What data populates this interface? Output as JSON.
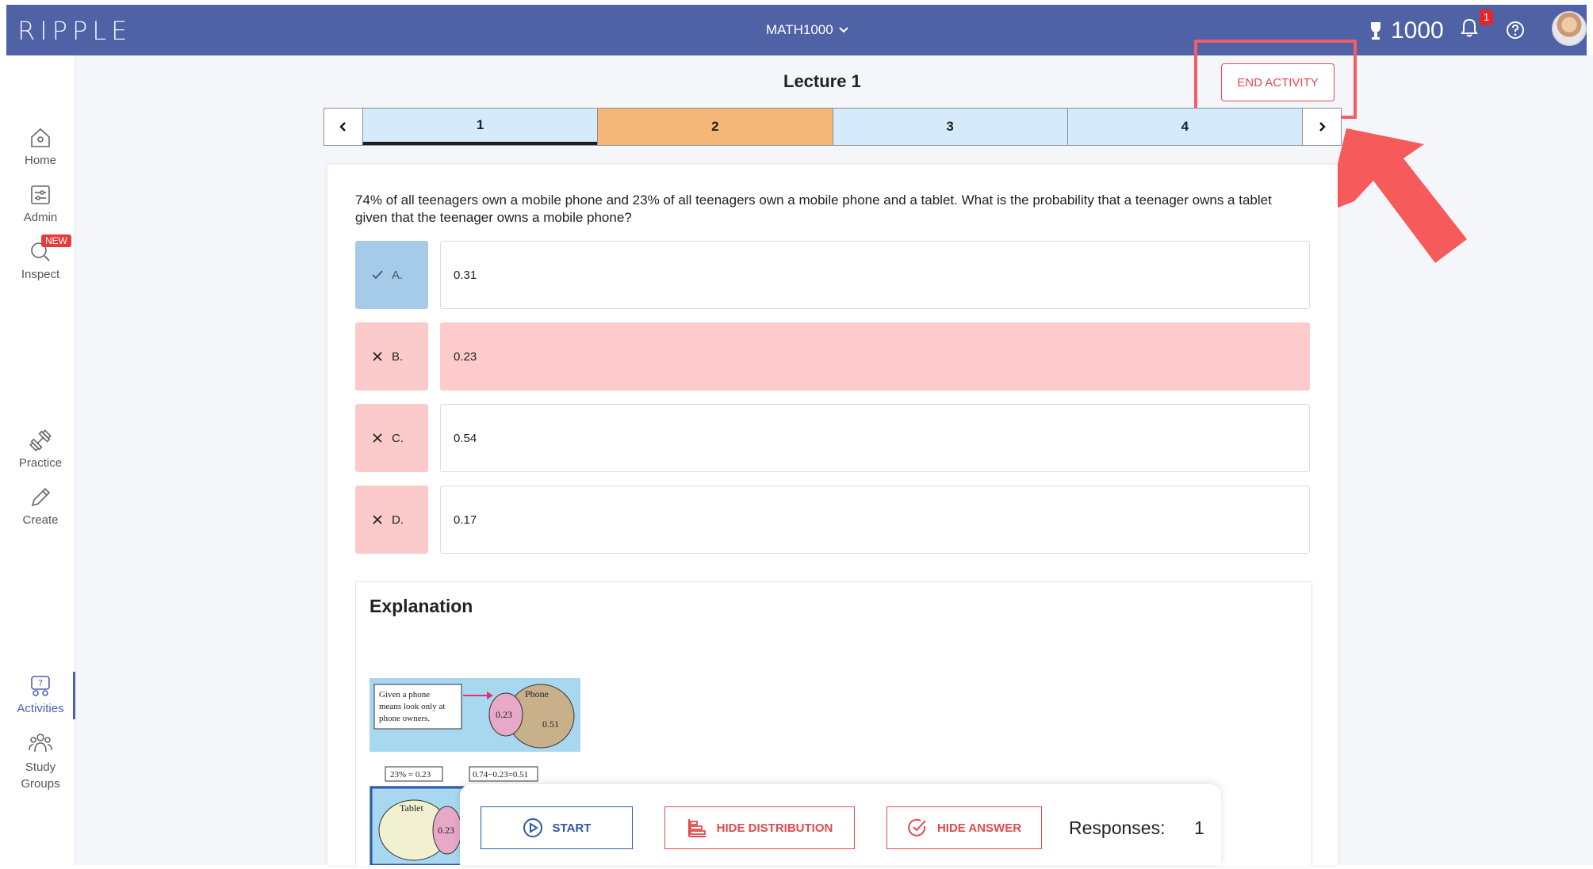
{
  "header": {
    "logo": "RIPPLE",
    "course": "MATH1000",
    "points": "1000",
    "notifications": "1"
  },
  "sidebar": {
    "items": [
      {
        "label": "Home",
        "icon": "home-icon"
      },
      {
        "label": "Admin",
        "icon": "admin-icon"
      },
      {
        "label": "Inspect",
        "icon": "inspect-icon",
        "badge": "NEW"
      },
      {
        "label": "Practice",
        "icon": "dumbbell-icon"
      },
      {
        "label": "Create",
        "icon": "pencil-icon"
      },
      {
        "label": "Activities",
        "icon": "activities-icon",
        "active": true
      },
      {
        "label": "Study",
        "label2": "Groups",
        "icon": "study-groups-icon"
      }
    ]
  },
  "activity": {
    "title": "Lecture 1",
    "end_label": "END ACTIVITY",
    "tabs": [
      "1",
      "2",
      "3",
      "4"
    ],
    "current_tab": "2"
  },
  "question": {
    "text": "74% of all teenagers own a mobile phone and 23% of all teenagers own a mobile phone and a tablet. What is the probability that a teenager owns a tablet given that the teenager owns a mobile phone?",
    "options": [
      {
        "letter": "A.",
        "text": "0.31",
        "status": "correct"
      },
      {
        "letter": "B.",
        "text": "0.23",
        "status": "wrong-selected"
      },
      {
        "letter": "C.",
        "text": "0.54",
        "status": "wrong"
      },
      {
        "letter": "D.",
        "text": "0.17",
        "status": "wrong"
      }
    ]
  },
  "explanation": {
    "title": "Explanation",
    "fig1_note": [
      "Given a phone",
      "means look only at",
      "phone owners."
    ],
    "fig1_circle_label": "Phone",
    "fig1_inner": "0.23",
    "fig1_outer": "0.51",
    "fig2_box1": "23% = 0.23",
    "fig2_box2": "0.74−0.23=0.51",
    "fig2_label": "Tablet",
    "fig2_inner": "0.23"
  },
  "controls": {
    "start": "START",
    "hide_distribution": "HIDE DISTRIBUTION",
    "hide_answer": "HIDE ANSWER",
    "responses_label": "Responses:",
    "responses_count": "1"
  },
  "colors": {
    "header": "#4f62a6",
    "correct": "#a6cbe8",
    "wrong": "#fbcaca",
    "current_tab": "#f4b777",
    "tab": "#d5eafb",
    "accent_red": "#e14b4b",
    "annotation": "#f25d66"
  }
}
